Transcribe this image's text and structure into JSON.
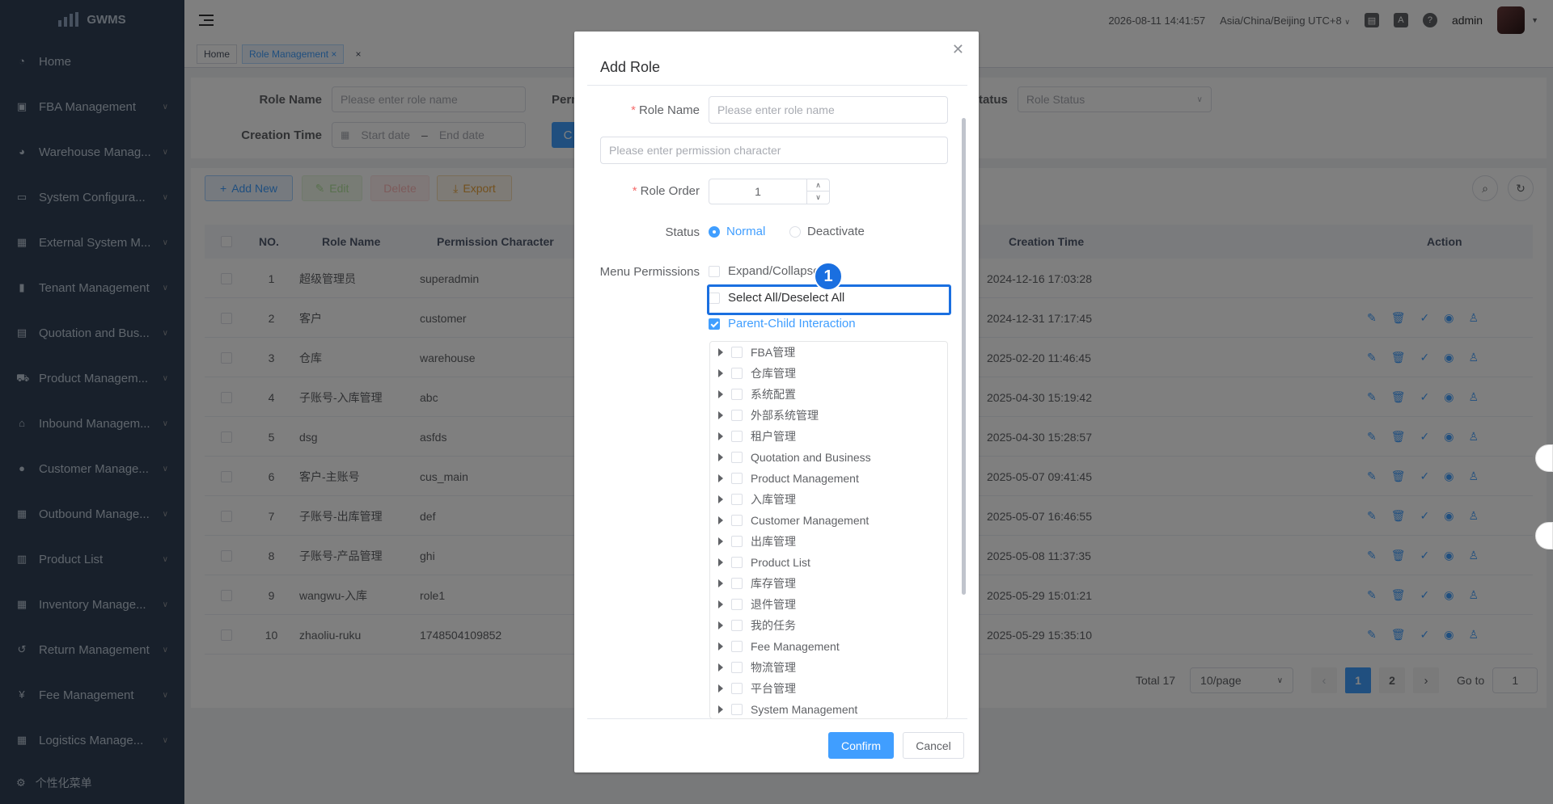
{
  "app": {
    "logo_text": "GWMS",
    "datetime": "2026-08-11 14:41:57",
    "timezone": "Asia/China/Beijing UTC+8",
    "user": "admin"
  },
  "sidebar": {
    "items": [
      {
        "label": "Home",
        "icon": "dashboard-icon",
        "arrow": false
      },
      {
        "label": "FBA Management",
        "icon": "book-icon",
        "arrow": true
      },
      {
        "label": "Warehouse Manag...",
        "icon": "globe-icon",
        "arrow": true
      },
      {
        "label": "System Configura...",
        "icon": "monitor-icon",
        "arrow": true
      },
      {
        "label": "External System M...",
        "icon": "grid-icon",
        "arrow": true
      },
      {
        "label": "Tenant Management",
        "icon": "chart-icon",
        "arrow": true
      },
      {
        "label": "Quotation and Bus...",
        "icon": "document-icon",
        "arrow": true
      },
      {
        "label": "Product Managem...",
        "icon": "cart-icon",
        "arrow": true
      },
      {
        "label": "Inbound Managem...",
        "icon": "home-icon",
        "arrow": true
      },
      {
        "label": "Customer Manage...",
        "icon": "user-icon",
        "arrow": true
      },
      {
        "label": "Outbound Manage...",
        "icon": "grid-icon",
        "arrow": true
      },
      {
        "label": "Product List",
        "icon": "list-icon",
        "arrow": true
      },
      {
        "label": "Inventory Manage...",
        "icon": "table-icon",
        "arrow": true
      },
      {
        "label": "Return Management",
        "icon": "return-icon",
        "arrow": true
      },
      {
        "label": "Fee Management",
        "icon": "yen-icon",
        "arrow": true
      },
      {
        "label": "Logistics Manage...",
        "icon": "grid-icon",
        "arrow": true
      }
    ],
    "bottom": "个性化菜单"
  },
  "tags": {
    "home": "Home",
    "current": "Role Management",
    "close_glyph": "×",
    "close_all_glyph": "×"
  },
  "search": {
    "role_name_label": "Role Name",
    "role_name_placeholder": "Please enter role name",
    "perm_label": "Perm",
    "status_label": "Status",
    "status_placeholder": "Role Status",
    "creation_time_label": "Creation Time",
    "start_placeholder": "Start date",
    "date_sep": "–",
    "end_placeholder": "End date",
    "search_btn": "C"
  },
  "toolbar": {
    "add": "Add New",
    "edit": "Edit",
    "delete": "Delete",
    "export": "Export"
  },
  "table": {
    "headers": {
      "no": "NO.",
      "name": "Role Name",
      "perm": "Permission Character",
      "time": "Creation Time",
      "action": "Action"
    },
    "rows": [
      {
        "no": "1",
        "name": "超级管理员",
        "perm": "superadmin",
        "time": "2024-12-16 17:03:28",
        "actions": false
      },
      {
        "no": "2",
        "name": "客户",
        "perm": "customer",
        "time": "2024-12-31 17:17:45",
        "actions": true
      },
      {
        "no": "3",
        "name": "仓库",
        "perm": "warehouse",
        "time": "2025-02-20 11:46:45",
        "actions": true
      },
      {
        "no": "4",
        "name": "子账号-入库管理",
        "perm": "abc",
        "time": "2025-04-30 15:19:42",
        "actions": true
      },
      {
        "no": "5",
        "name": "dsg",
        "perm": "asfds",
        "time": "2025-04-30 15:28:57",
        "actions": true
      },
      {
        "no": "6",
        "name": "客户-主账号",
        "perm": "cus_main",
        "time": "2025-05-07 09:41:45",
        "actions": true
      },
      {
        "no": "7",
        "name": "子账号-出库管理",
        "perm": "def",
        "time": "2025-05-07 16:46:55",
        "actions": true
      },
      {
        "no": "8",
        "name": "子账号-产品管理",
        "perm": "ghi",
        "time": "2025-05-08 11:37:35",
        "actions": true
      },
      {
        "no": "9",
        "name": "wangwu-入库",
        "perm": "role1",
        "time": "2025-05-29 15:01:21",
        "actions": true
      },
      {
        "no": "10",
        "name": "zhaoliu-ruku",
        "perm": "1748504109852",
        "time": "2025-05-29 15:35:10",
        "actions": true
      }
    ]
  },
  "pagination": {
    "total": "Total 17",
    "page_size": "10/page",
    "pages": [
      "1",
      "2"
    ],
    "current": "1",
    "goto_label": "Go to",
    "goto_value": "1"
  },
  "dialog": {
    "title": "Add Role",
    "role_name_label": "Role Name",
    "role_name_placeholder": "Please enter role name",
    "perm_placeholder": "Please enter permission character",
    "role_order_label": "Role Order",
    "role_order_value": "1",
    "status_label": "Status",
    "status_normal": "Normal",
    "status_deactivate": "Deactivate",
    "menu_perm_label": "Menu Permissions",
    "expand_collapse": "Expand/Collapse",
    "select_all": "Select All/Deselect All",
    "parent_child": "Parent-Child Interaction",
    "tree": [
      "FBA管理",
      "仓库管理",
      "系统配置",
      "外部系统管理",
      "租户管理",
      "Quotation and Business",
      "Product Management",
      "入库管理",
      "Customer Management",
      "出库管理",
      "Product List",
      "库存管理",
      "退件管理",
      "我的任务",
      "Fee Management",
      "物流管理",
      "平台管理",
      "System Management"
    ],
    "confirm": "Confirm",
    "cancel": "Cancel",
    "step_badge": "1"
  },
  "colors": {
    "primary": "#409eff",
    "sidebar_bg": "#304156",
    "highlight": "#1a6fe0"
  }
}
